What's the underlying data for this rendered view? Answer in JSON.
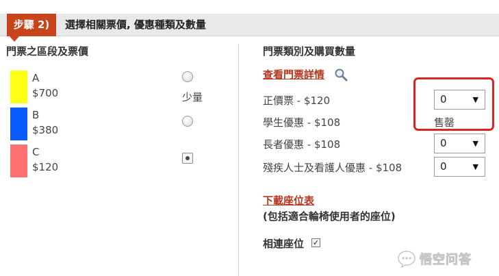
{
  "step": {
    "badge": "步驟 2)",
    "title": "選擇相關票價, 優惠種類及數量"
  },
  "left_panel": {
    "heading": "門票之區段及票價",
    "zones": [
      {
        "name": "A",
        "price": "$700",
        "color": "#ffff14",
        "note": "少量",
        "selected": false
      },
      {
        "name": "B",
        "price": "$380",
        "color": "#0a5cff",
        "note": "",
        "selected": false
      },
      {
        "name": "C",
        "price": "$120",
        "color": "#ff7070",
        "note": "",
        "selected": true
      }
    ]
  },
  "right_panel": {
    "heading": "門票類別及購買數量",
    "details_link": "查看門票詳情",
    "tickets": [
      {
        "label": "正價票 - $120",
        "quantity": "0",
        "status": ""
      },
      {
        "label": "學生優惠 - $108",
        "quantity": "",
        "status": "售罄"
      },
      {
        "label": "長者優惠 - $108",
        "quantity": "0",
        "status": ""
      },
      {
        "label": "殘疾人士及看護人優惠 - $108",
        "quantity": "0",
        "status": ""
      }
    ],
    "select_arrow": "▼",
    "download_link": "下載座位表",
    "wheelchair_note": "(包括適合輪椅使用者的座位)",
    "adjacent_label": "相連座位",
    "adjacent_checked": "✓"
  },
  "watermark": {
    "text": "悟空问答"
  },
  "colors": {
    "accent": "#c8451c",
    "link": "#b5361c",
    "highlight": "#d9241f"
  }
}
